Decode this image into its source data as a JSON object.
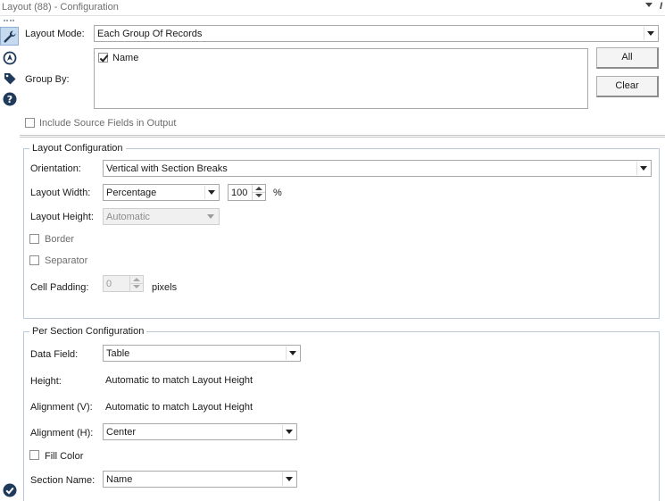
{
  "window": {
    "title": "Layout (88) - Configuration"
  },
  "toolbar": {
    "tools": [
      {
        "name": "wrench-icon",
        "active": true
      },
      {
        "name": "navigator-icon",
        "active": false
      },
      {
        "name": "tag-icon",
        "active": false
      },
      {
        "name": "help-icon",
        "active": false
      }
    ]
  },
  "top": {
    "layout_mode_label": "Layout Mode:",
    "layout_mode_value": "Each Group Of Records",
    "group_by_label": "Group By:",
    "group_by_items": [
      {
        "label": "Name",
        "checked": true
      }
    ],
    "all_button": "All",
    "clear_button": "Clear",
    "include_source_label": "Include Source Fields in Output",
    "include_source_checked": false
  },
  "layout_config": {
    "title": "Layout Configuration",
    "orientation_label": "Orientation:",
    "orientation_value": "Vertical with Section Breaks",
    "width_label": "Layout Width:",
    "width_mode": "Percentage",
    "width_value": "100",
    "width_unit": "%",
    "height_label": "Layout Height:",
    "height_value": "Automatic",
    "border_label": "Border",
    "border_checked": false,
    "separator_label": "Separator",
    "separator_checked": false,
    "padding_label": "Cell Padding:",
    "padding_value": "0",
    "padding_unit": "pixels"
  },
  "section_config": {
    "title": "Per Section Configuration",
    "data_field_label": "Data Field:",
    "data_field_value": "Table",
    "height_label": "Height:",
    "height_value": "Automatic to match Layout Height",
    "align_v_label": "Alignment (V):",
    "align_v_value": "Automatic to match Layout Height",
    "align_h_label": "Alignment (H):",
    "align_h_value": "Center",
    "fill_color_label": "Fill Color",
    "fill_color_checked": false,
    "section_name_label": "Section Name:",
    "section_name_value": "Name"
  },
  "status": {
    "icon": "check-circle-icon"
  }
}
